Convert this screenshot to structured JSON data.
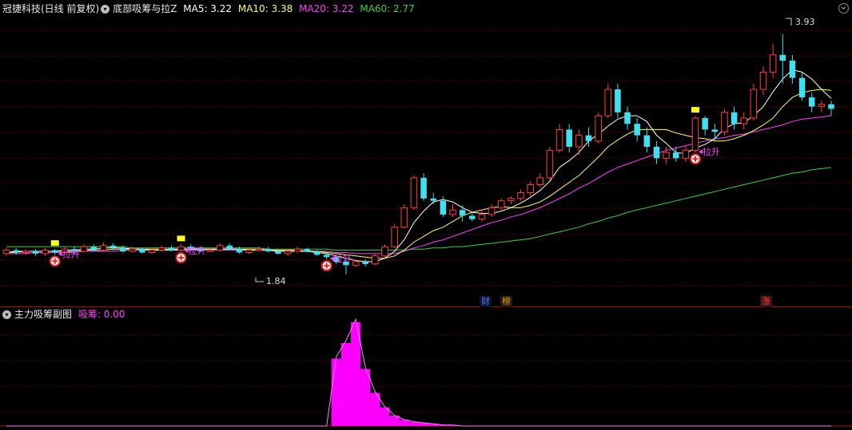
{
  "main_header": {
    "stock_title": "冠捷科技(日线 前复权)",
    "indicator_name": "底部吸筹与拉Z",
    "ma5": "MA5: 3.22",
    "ma10": "MA10: 3.38",
    "ma20": "MA20: 3.22",
    "ma60": "MA60: 2.77"
  },
  "sub_header": {
    "panel_title": "主力吸筹副图",
    "value_label": "吸筹: 0.00"
  },
  "price_labels": {
    "high": "3.93",
    "low": "1.84"
  },
  "signal_labels": {
    "lift": "拉升"
  },
  "news_tags": [
    {
      "label": "财",
      "color": "#2a5fd6",
      "bg": "#1a1a3a"
    },
    {
      "label": "榜",
      "color": "#e0a010",
      "bg": "#3a2a00"
    },
    {
      "label": "涨",
      "color": "#e03030",
      "bg": "#3a1010"
    }
  ],
  "colors": {
    "up": "#ff4040",
    "down": "#40e0f0",
    "ma5": "#ffffff",
    "ma10": "#ffff60",
    "ma20": "#ff40ff",
    "ma60": "#40d040",
    "grid": "#6a0000",
    "bars": "#ff00ff"
  },
  "chart_data": [
    {
      "type": "candlestick",
      "title": "冠捷科技(日线 前复权)",
      "ylim": [
        1.7,
        4.0
      ],
      "candles": [
        [
          2.02,
          2.05,
          2.07,
          2.0
        ],
        [
          2.05,
          2.03,
          2.07,
          2.01
        ],
        [
          2.03,
          2.04,
          2.06,
          2.01
        ],
        [
          2.04,
          2.02,
          2.06,
          2.0
        ],
        [
          2.02,
          2.05,
          2.07,
          2.0
        ],
        [
          2.05,
          2.03,
          2.06,
          2.01
        ],
        [
          2.03,
          2.06,
          2.08,
          2.02
        ],
        [
          2.06,
          2.04,
          2.08,
          2.02
        ],
        [
          2.04,
          2.08,
          2.1,
          2.03
        ],
        [
          2.08,
          2.05,
          2.1,
          2.04
        ],
        [
          2.05,
          2.09,
          2.12,
          2.04
        ],
        [
          2.09,
          2.07,
          2.11,
          2.05
        ],
        [
          2.07,
          2.04,
          2.09,
          2.03
        ],
        [
          2.04,
          2.06,
          2.08,
          2.03
        ],
        [
          2.06,
          2.03,
          2.07,
          2.02
        ],
        [
          2.03,
          2.05,
          2.07,
          2.02
        ],
        [
          2.05,
          2.07,
          2.09,
          2.04
        ],
        [
          2.07,
          2.05,
          2.09,
          2.04
        ],
        [
          2.05,
          2.08,
          2.1,
          2.04
        ],
        [
          2.08,
          2.06,
          2.1,
          2.05
        ],
        [
          2.06,
          2.04,
          2.08,
          2.03
        ],
        [
          2.04,
          2.05,
          2.07,
          2.03
        ],
        [
          2.05,
          2.09,
          2.11,
          2.04
        ],
        [
          2.09,
          2.06,
          2.11,
          2.05
        ],
        [
          2.06,
          2.03,
          2.08,
          2.02
        ],
        [
          2.03,
          2.05,
          2.07,
          2.02
        ],
        [
          2.05,
          2.06,
          2.08,
          2.04
        ],
        [
          2.06,
          2.04,
          2.08,
          2.03
        ],
        [
          2.04,
          2.02,
          2.06,
          2.01
        ],
        [
          2.02,
          2.04,
          2.06,
          2.0
        ],
        [
          2.04,
          2.06,
          2.08,
          2.03
        ],
        [
          2.06,
          2.04,
          2.07,
          2.03
        ],
        [
          2.04,
          2.01,
          2.05,
          2.0
        ],
        [
          2.01,
          1.99,
          2.03,
          1.97
        ],
        [
          1.99,
          1.95,
          2.0,
          1.93
        ],
        [
          1.95,
          1.92,
          1.97,
          1.84
        ],
        [
          1.92,
          1.95,
          1.97,
          1.9
        ],
        [
          1.95,
          1.93,
          1.97,
          1.91
        ],
        [
          1.93,
          2.0,
          2.02,
          1.92
        ],
        [
          2.0,
          2.08,
          2.1,
          1.99
        ],
        [
          2.08,
          2.25,
          2.28,
          2.07
        ],
        [
          2.25,
          2.42,
          2.45,
          2.24
        ],
        [
          2.42,
          2.68,
          2.7,
          2.4
        ],
        [
          2.68,
          2.5,
          2.72,
          2.48
        ],
        [
          2.5,
          2.48,
          2.55,
          2.45
        ],
        [
          2.48,
          2.36,
          2.52,
          2.34
        ],
        [
          2.36,
          2.4,
          2.45,
          2.34
        ],
        [
          2.4,
          2.35,
          2.44,
          2.3
        ],
        [
          2.35,
          2.32,
          2.38,
          2.3
        ],
        [
          2.32,
          2.36,
          2.4,
          2.3
        ],
        [
          2.36,
          2.42,
          2.45,
          2.34
        ],
        [
          2.42,
          2.48,
          2.5,
          2.4
        ],
        [
          2.48,
          2.5,
          2.52,
          2.45
        ],
        [
          2.5,
          2.55,
          2.58,
          2.48
        ],
        [
          2.55,
          2.62,
          2.65,
          2.52
        ],
        [
          2.62,
          2.68,
          2.72,
          2.6
        ],
        [
          2.68,
          2.92,
          2.95,
          2.66
        ],
        [
          2.92,
          3.1,
          3.15,
          2.9
        ],
        [
          3.1,
          2.95,
          3.15,
          2.9
        ],
        [
          2.95,
          3.05,
          3.1,
          2.88
        ],
        [
          3.05,
          3.0,
          3.12,
          2.95
        ],
        [
          3.0,
          3.22,
          3.25,
          2.98
        ],
        [
          3.22,
          3.45,
          3.5,
          3.2
        ],
        [
          3.45,
          3.25,
          3.5,
          3.2
        ],
        [
          3.25,
          3.15,
          3.3,
          3.1
        ],
        [
          3.15,
          3.05,
          3.2,
          3.0
        ],
        [
          3.05,
          2.95,
          3.12,
          2.9
        ],
        [
          2.95,
          2.85,
          3.0,
          2.8
        ],
        [
          2.85,
          2.9,
          2.95,
          2.8
        ],
        [
          2.9,
          2.85,
          2.95,
          2.82
        ],
        [
          2.85,
          2.92,
          2.96,
          2.82
        ],
        [
          2.92,
          3.2,
          3.22,
          2.9
        ],
        [
          3.2,
          3.1,
          3.22,
          3.05
        ],
        [
          3.1,
          3.08,
          3.15,
          3.0
        ],
        [
          3.08,
          3.25,
          3.28,
          3.05
        ],
        [
          3.25,
          3.15,
          3.3,
          3.1
        ],
        [
          3.15,
          3.2,
          3.25,
          3.1
        ],
        [
          3.2,
          3.45,
          3.5,
          3.18
        ],
        [
          3.45,
          3.6,
          3.65,
          3.4
        ],
        [
          3.6,
          3.75,
          3.85,
          3.55
        ],
        [
          3.75,
          3.7,
          3.93,
          3.5
        ],
        [
          3.7,
          3.55,
          3.75,
          3.5
        ],
        [
          3.55,
          3.38,
          3.6,
          3.35
        ],
        [
          3.38,
          3.3,
          3.42,
          3.25
        ],
        [
          3.3,
          3.32,
          3.35,
          3.25
        ],
        [
          3.32,
          3.28,
          3.35,
          3.22
        ]
      ],
      "ma5": [
        2.03,
        2.04,
        2.04,
        2.04,
        2.04,
        2.04,
        2.05,
        2.05,
        2.06,
        2.06,
        2.07,
        2.07,
        2.07,
        2.06,
        2.06,
        2.05,
        2.05,
        2.05,
        2.06,
        2.06,
        2.06,
        2.06,
        2.06,
        2.06,
        2.06,
        2.05,
        2.05,
        2.05,
        2.04,
        2.04,
        2.04,
        2.04,
        2.03,
        2.02,
        2.0,
        1.98,
        1.96,
        1.95,
        1.95,
        1.98,
        2.04,
        2.14,
        2.29,
        2.39,
        2.47,
        2.49,
        2.47,
        2.42,
        2.38,
        2.37,
        2.37,
        2.39,
        2.42,
        2.46,
        2.51,
        2.57,
        2.65,
        2.77,
        2.83,
        2.9,
        3.0,
        3.06,
        3.13,
        3.19,
        3.22,
        3.22,
        3.17,
        3.05,
        2.98,
        2.9,
        2.89,
        2.94,
        2.97,
        3.02,
        3.11,
        3.15,
        3.16,
        3.22,
        3.3,
        3.43,
        3.54,
        3.62,
        3.6,
        3.54,
        3.45,
        3.37
      ],
      "ma10": [
        2.03,
        2.03,
        2.04,
        2.04,
        2.04,
        2.04,
        2.04,
        2.04,
        2.05,
        2.05,
        2.05,
        2.06,
        2.06,
        2.06,
        2.06,
        2.06,
        2.06,
        2.06,
        2.06,
        2.06,
        2.06,
        2.06,
        2.06,
        2.06,
        2.06,
        2.06,
        2.06,
        2.05,
        2.05,
        2.05,
        2.05,
        2.04,
        2.04,
        2.03,
        2.02,
        2.01,
        2.0,
        1.99,
        1.98,
        1.98,
        2.0,
        2.05,
        2.12,
        2.17,
        2.22,
        2.25,
        2.3,
        2.35,
        2.38,
        2.4,
        2.42,
        2.43,
        2.42,
        2.42,
        2.44,
        2.47,
        2.52,
        2.58,
        2.64,
        2.7,
        2.78,
        2.86,
        2.95,
        3.01,
        3.06,
        3.1,
        3.1,
        3.1,
        3.1,
        3.07,
        3.05,
        3.03,
        3.02,
        3.0,
        3.0,
        3.02,
        3.05,
        3.09,
        3.14,
        3.2,
        3.3,
        3.38,
        3.42,
        3.44,
        3.45,
        3.44
      ],
      "ma20": [
        2.02,
        2.02,
        2.02,
        2.03,
        2.03,
        2.03,
        2.03,
        2.03,
        2.04,
        2.04,
        2.04,
        2.04,
        2.05,
        2.05,
        2.05,
        2.05,
        2.05,
        2.05,
        2.05,
        2.05,
        2.05,
        2.05,
        2.05,
        2.05,
        2.05,
        2.05,
        2.05,
        2.05,
        2.05,
        2.05,
        2.05,
        2.04,
        2.04,
        2.04,
        2.03,
        2.03,
        2.02,
        2.02,
        2.02,
        2.02,
        2.02,
        2.04,
        2.07,
        2.09,
        2.12,
        2.14,
        2.17,
        2.2,
        2.23,
        2.26,
        2.29,
        2.31,
        2.34,
        2.36,
        2.39,
        2.42,
        2.46,
        2.5,
        2.54,
        2.59,
        2.63,
        2.68,
        2.73,
        2.77,
        2.8,
        2.83,
        2.86,
        2.89,
        2.92,
        2.94,
        2.96,
        2.98,
        3.0,
        3.02,
        3.03,
        3.05,
        3.06,
        3.08,
        3.1,
        3.12,
        3.14,
        3.17,
        3.19,
        3.2,
        3.21,
        3.22
      ],
      "ma60": [
        2.08,
        2.08,
        2.08,
        2.08,
        2.08,
        2.08,
        2.08,
        2.08,
        2.08,
        2.08,
        2.08,
        2.08,
        2.08,
        2.07,
        2.07,
        2.07,
        2.07,
        2.07,
        2.07,
        2.07,
        2.07,
        2.07,
        2.07,
        2.07,
        2.07,
        2.07,
        2.07,
        2.06,
        2.06,
        2.06,
        2.06,
        2.06,
        2.06,
        2.06,
        2.05,
        2.05,
        2.05,
        2.05,
        2.05,
        2.05,
        2.05,
        2.05,
        2.06,
        2.06,
        2.07,
        2.07,
        2.08,
        2.08,
        2.09,
        2.1,
        2.11,
        2.12,
        2.13,
        2.14,
        2.15,
        2.17,
        2.19,
        2.21,
        2.23,
        2.25,
        2.28,
        2.3,
        2.33,
        2.35,
        2.38,
        2.4,
        2.42,
        2.44,
        2.46,
        2.48,
        2.5,
        2.52,
        2.54,
        2.56,
        2.58,
        2.6,
        2.62,
        2.64,
        2.66,
        2.68,
        2.7,
        2.72,
        2.73,
        2.75,
        2.76,
        2.77
      ],
      "signal_indices": [
        5,
        18,
        33,
        71
      ],
      "yellow_indices": [
        5,
        18,
        71
      ]
    },
    {
      "type": "bar",
      "title": "主力吸筹副图",
      "series": [
        {
          "name": "吸筹",
          "values": [
            0,
            0,
            0,
            0,
            0,
            0,
            0,
            0,
            0,
            0,
            0,
            0,
            0,
            0,
            0,
            0,
            0,
            0,
            0,
            0,
            0,
            0,
            0,
            0,
            0,
            0,
            0,
            0,
            0,
            0,
            0,
            0,
            0,
            0,
            0.65,
            0.8,
            1.0,
            0.55,
            0.32,
            0.18,
            0.1,
            0.06,
            0.04,
            0.03,
            0.02,
            0.01,
            0.01,
            0,
            0,
            0,
            0,
            0,
            0,
            0,
            0,
            0,
            0,
            0,
            0,
            0,
            0,
            0,
            0,
            0,
            0,
            0,
            0,
            0,
            0,
            0,
            0,
            0,
            0,
            0,
            0,
            0,
            0,
            0,
            0,
            0,
            0,
            0,
            0,
            0,
            0,
            0
          ]
        }
      ]
    }
  ]
}
